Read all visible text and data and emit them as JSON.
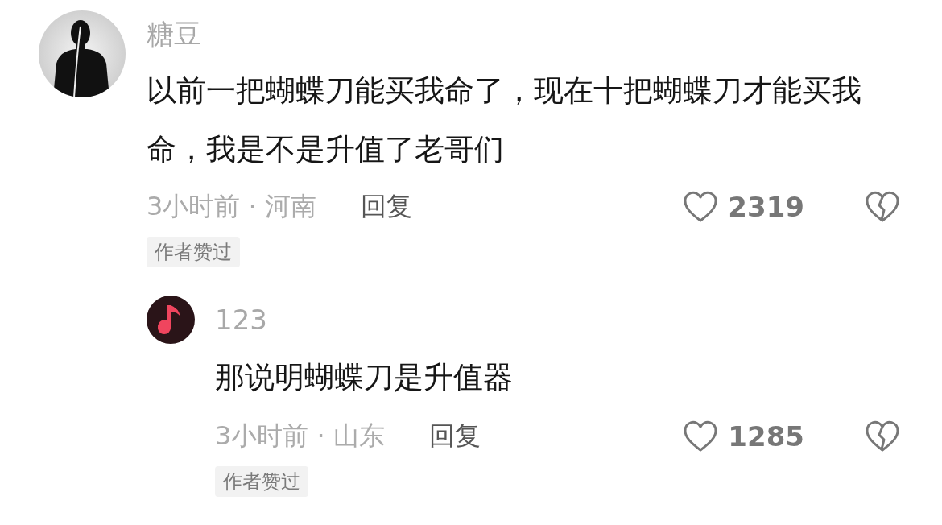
{
  "comments": [
    {
      "author": "糖豆",
      "text": "以前一把蝴蝶刀能买我命了，现在十把蝴蝶刀才能买我命，我是不是升值了老哥们",
      "meta": "3小时前 · 河南",
      "reply_label": "回复",
      "likes": "2319",
      "badge": "作者赞过",
      "replies": [
        {
          "author": "123",
          "avatar": {
            "kind": "music-note"
          },
          "text": "那说明蝴蝶刀是升值器",
          "meta": "3小时前 · 山东",
          "reply_label": "回复",
          "likes": "1285",
          "badge": "作者赞过"
        }
      ]
    }
  ]
}
